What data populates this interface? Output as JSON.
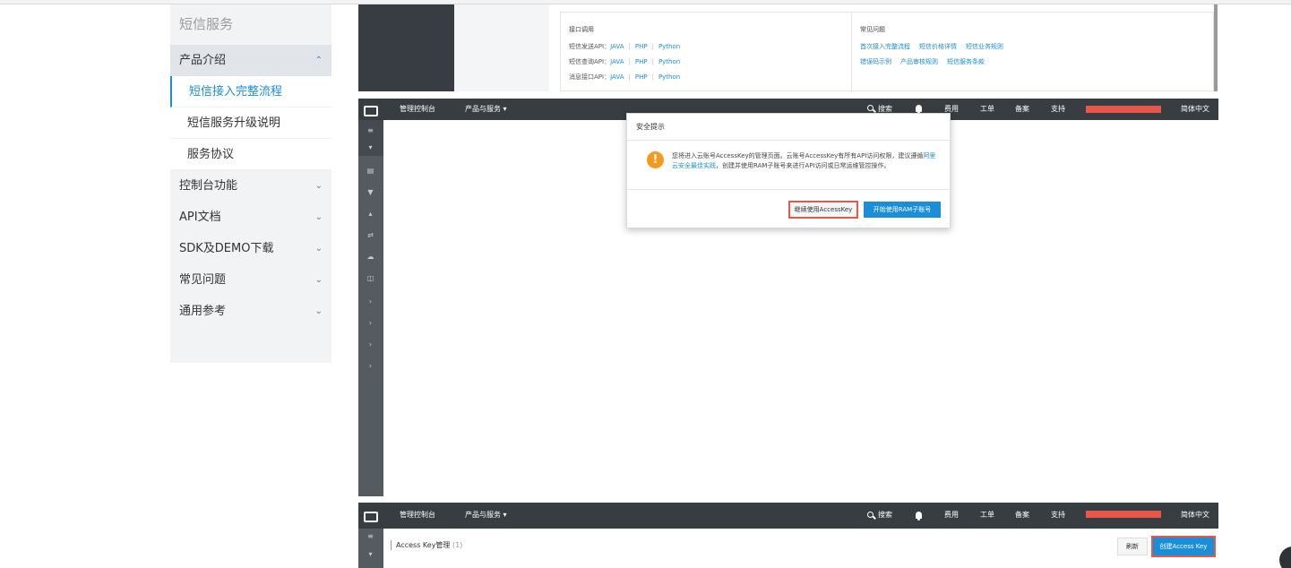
{
  "leftnav": {
    "title": "短信服务",
    "items": [
      {
        "label": "产品介绍",
        "state": "open"
      },
      {
        "label": "控制台功能"
      },
      {
        "label": "API文档"
      },
      {
        "label": "SDK及DEMO下载"
      },
      {
        "label": "常见问题"
      },
      {
        "label": "通用参考"
      }
    ],
    "sub_items": [
      "短信接入完整流程",
      "短信服务升级说明",
      "服务协议"
    ]
  },
  "product_box": {
    "api_heading": "接口调用",
    "api_rows": [
      {
        "label": "短信发送API："
      },
      {
        "label": "短信查询API："
      },
      {
        "label": "消息接口API："
      }
    ],
    "langs": [
      "JAVA",
      "PHP",
      "Python"
    ],
    "faq_heading": "常见问题",
    "faq_links": [
      "首次接入完整流程",
      "短信价格详情",
      "短信业务规则",
      "错误码示例",
      "产品审核规则",
      "短信服务条款"
    ]
  },
  "topbar": {
    "console": "管理控制台",
    "products": "产品与服务",
    "search": "搜索",
    "billing": "费用",
    "ticket": "工单",
    "icp": "备案",
    "support": "支持",
    "language": "简体中文"
  },
  "dialog": {
    "title": "安全提示",
    "message": "您将进入云账号AccessKey的管理页面。云账号AccessKey有所有API访问权限，建议遵循",
    "link": "阿里云安全最佳实践",
    "message_tail": "，创建并使用RAM子账号来进行API访问或日常运维管控操作。",
    "continue_button": "继续使用AccessKey",
    "ram_button": "开始使用RAM子账号"
  },
  "accesskey": {
    "title": "Access Key管理",
    "count": "(1)",
    "refresh": "刷新",
    "create": "创建Access Key"
  },
  "colors": {
    "accent": "#1a8fd7",
    "topbar": "#373d41",
    "highlight": "#e8584a",
    "warning": "#f49b1e"
  }
}
